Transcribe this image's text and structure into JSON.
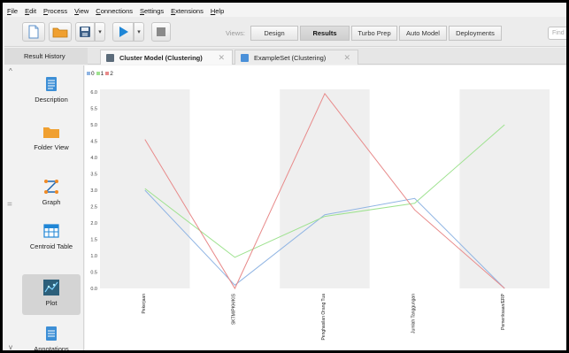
{
  "menu": [
    "File",
    "Edit",
    "Process",
    "View",
    "Connections",
    "Settings",
    "Extensions",
    "Help"
  ],
  "toolbar": {
    "views_label": "Views:",
    "view_tabs": [
      "Design",
      "Results",
      "Turbo Prep",
      "Auto Model",
      "Deployments"
    ],
    "active_view": "Results",
    "find_placeholder": "Find"
  },
  "tabs": {
    "result_history": "Result History",
    "items": [
      {
        "label": "Cluster Model (Clustering)",
        "active": true,
        "icon_color": "#5b6b7a"
      },
      {
        "label": "ExampleSet (Clustering)",
        "active": false,
        "icon_color": "#4a90d9"
      }
    ]
  },
  "sidebar": {
    "items": [
      {
        "label": "Description",
        "icon": "document-icon"
      },
      {
        "label": "Folder View",
        "icon": "folder-icon"
      },
      {
        "label": "Graph",
        "icon": "graph-icon"
      },
      {
        "label": "Centroid Table",
        "icon": "table-icon"
      },
      {
        "label": "Plot",
        "icon": "plot-icon",
        "active": true
      },
      {
        "label": "Annotations",
        "icon": "annotations-icon"
      }
    ]
  },
  "colors": {
    "cluster_0": "#8fb4e3",
    "cluster_1": "#9ee28f",
    "cluster_2": "#e88a8a",
    "band": "#efefef"
  },
  "chart_data": {
    "type": "line",
    "categories": [
      "Pekerjaan",
      "SKTM/PKH/KIS",
      "Penghasilan Orang Tua",
      "Jumlah Tanggungan",
      "Pemeriksaan/ERP"
    ],
    "series": [
      {
        "name": "0",
        "values": [
          3.0,
          0.1,
          2.25,
          2.75,
          0.0
        ]
      },
      {
        "name": "1",
        "values": [
          3.05,
          0.95,
          2.2,
          2.6,
          5.0
        ]
      },
      {
        "name": "2",
        "values": [
          4.55,
          0.0,
          5.95,
          2.4,
          0.0
        ]
      }
    ],
    "y_ticks": [
      "0.0",
      "0.5",
      "1.0",
      "1.5",
      "2.0",
      "2.5",
      "3.0",
      "3.5",
      "4.0",
      "4.5",
      "5.0",
      "5.5",
      "6.0"
    ],
    "ylim": [
      0,
      6
    ],
    "legend_position": "top-left",
    "grid": false
  }
}
